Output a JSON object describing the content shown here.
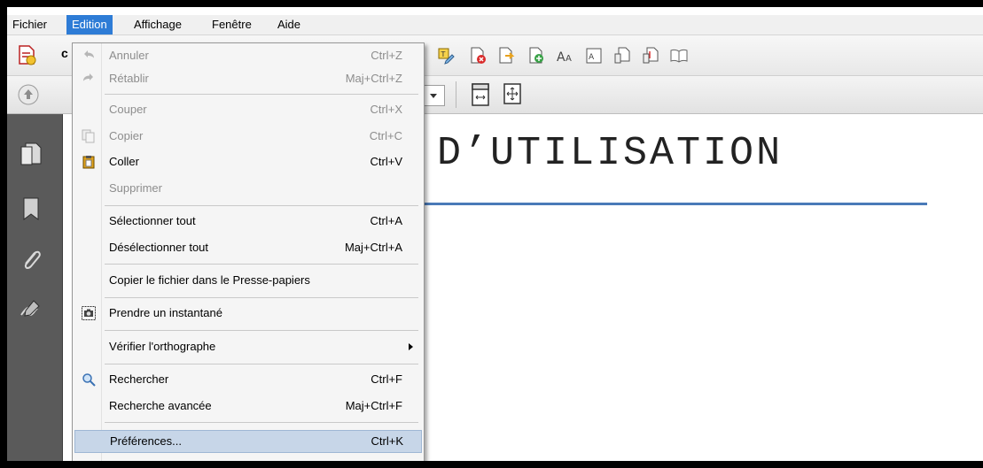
{
  "menubar": {
    "items": [
      "Fichier",
      "Edition",
      "Affichage",
      "Fenêtre",
      "Aide"
    ],
    "active": "Edition"
  },
  "colors": {
    "menu_active": "#2e7cd6",
    "menu_highlight": "#c7d6e8",
    "rule": "#4a7ab8",
    "sidebar": "#5a5a5a"
  },
  "toolbar": {
    "icons": [
      "create-pdf-icon",
      "highlight-icon",
      "delete-page-icon",
      "extract-page-icon",
      "insert-page-icon",
      "text-size-icon",
      "image-icon",
      "document-icon",
      "document-icon",
      "book-icon"
    ],
    "partial_label": "c"
  },
  "sidebar": {
    "icons": [
      "pages-icon",
      "bookmark-icon",
      "attachment-icon",
      "signature-icon"
    ]
  },
  "document": {
    "title": "DE D’UTILISATION"
  },
  "edit_menu": {
    "items": [
      {
        "label": "Annuler",
        "shortcut": "Ctrl+Z",
        "enabled": false,
        "icon": "undo-icon"
      },
      {
        "label": "Rétablir",
        "shortcut": "Maj+Ctrl+Z",
        "enabled": false,
        "icon": "redo-icon"
      },
      {
        "label": "Couper",
        "shortcut": "Ctrl+X",
        "enabled": false
      },
      {
        "label": "Copier",
        "shortcut": "Ctrl+C",
        "enabled": false,
        "icon": "copy-icon"
      },
      {
        "label": "Coller",
        "shortcut": "Ctrl+V",
        "enabled": true,
        "icon": "paste-icon"
      },
      {
        "label": "Supprimer",
        "shortcut": "",
        "enabled": false
      },
      {
        "label": "Sélectionner tout",
        "shortcut": "Ctrl+A",
        "enabled": true
      },
      {
        "label": "Désélectionner tout",
        "shortcut": "Maj+Ctrl+A",
        "enabled": true
      },
      {
        "label": "Copier le fichier dans le Presse-papiers",
        "shortcut": "",
        "enabled": true
      },
      {
        "label": "Prendre un instantané",
        "shortcut": "",
        "enabled": true,
        "icon": "camera-icon"
      },
      {
        "label": "Vérifier l'orthographe",
        "shortcut": "",
        "enabled": true,
        "submenu": true
      },
      {
        "label": "Rechercher",
        "shortcut": "Ctrl+F",
        "enabled": true,
        "icon": "search-icon"
      },
      {
        "label": "Recherche avancée",
        "shortcut": "Maj+Ctrl+F",
        "enabled": true
      },
      {
        "label": "Préférences...",
        "shortcut": "Ctrl+K",
        "enabled": true,
        "highlighted": true
      }
    ]
  }
}
